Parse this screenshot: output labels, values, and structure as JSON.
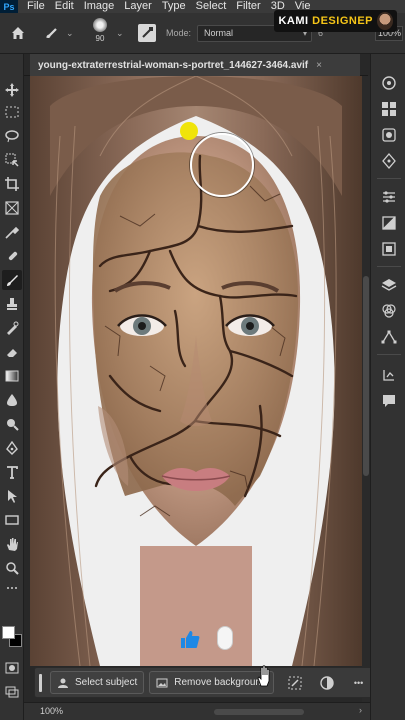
{
  "menubar": {
    "logo": "Ps",
    "items": [
      "File",
      "Edit",
      "Image",
      "Layer",
      "Type",
      "Select",
      "Filter",
      "3D",
      "Vie"
    ]
  },
  "watermark": {
    "part1": "KAMI",
    "part2": "DESIGNEP"
  },
  "options": {
    "brush_size": "90",
    "mode_label": "Mode:",
    "mode_value": "Normal",
    "opacity_fragment": "6",
    "opacity_value": "100%"
  },
  "document": {
    "tab_title": "young-extraterrestrial-woman-s-portret_144627-3464.avif",
    "close": "×"
  },
  "taskbar": {
    "select_subject": "Select subject",
    "remove_background": "Remove background",
    "more": "•••"
  },
  "status": {
    "zoom": "100%"
  },
  "colors": {
    "accent_blue": "#31a8ff",
    "indicator_yellow": "#f0e40a",
    "foreground": "#ffffff",
    "background": "#000000"
  },
  "icons": {
    "tools": [
      "move-icon",
      "marquee-icon",
      "lasso-icon",
      "object-select-icon",
      "crop-icon",
      "frame-icon",
      "eyedropper-icon",
      "healing-brush-icon",
      "brush-icon",
      "clone-stamp-icon",
      "history-brush-icon",
      "eraser-icon",
      "gradient-icon",
      "blur-icon",
      "dodge-icon",
      "pen-icon",
      "type-icon",
      "path-select-icon",
      "rectangle-icon",
      "hand-icon",
      "zoom-icon"
    ],
    "dock": [
      "color-panel-icon",
      "swatches-icon",
      "adjustments-icon",
      "learn-icon",
      "libraries-icon",
      "properties-icon",
      "layers-icon",
      "channels-icon",
      "paths-icon",
      "history-icon",
      "comments-icon"
    ]
  }
}
